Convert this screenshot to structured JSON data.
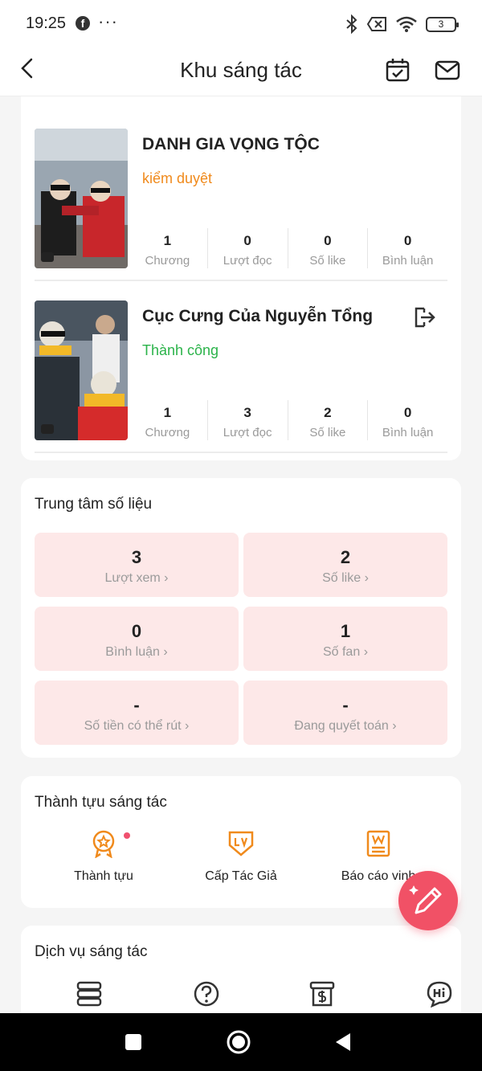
{
  "status_bar": {
    "time": "19:25",
    "battery": "3"
  },
  "header": {
    "title": "Khu sáng tác"
  },
  "works": [
    {
      "title": "DANH GIA VỌNG TỘC",
      "status": "kiểm duyệt",
      "status_color": "#f08a1c",
      "stats": [
        {
          "value": "1",
          "label": "Chương"
        },
        {
          "value": "0",
          "label": "Lượt đọc"
        },
        {
          "value": "0",
          "label": "Số like"
        },
        {
          "value": "0",
          "label": "Bình luận"
        }
      ]
    },
    {
      "title": "Cục Cưng Của Nguyễn Tổng",
      "status": "Thành công",
      "status_color": "#2bb34a",
      "stats": [
        {
          "value": "1",
          "label": "Chương"
        },
        {
          "value": "3",
          "label": "Lượt đọc"
        },
        {
          "value": "2",
          "label": "Số like"
        },
        {
          "value": "0",
          "label": "Bình luận"
        }
      ]
    }
  ],
  "data_center": {
    "title": "Trung tâm số liệu",
    "tiles": [
      {
        "value": "3",
        "label": "Lượt xem"
      },
      {
        "value": "2",
        "label": "Số like"
      },
      {
        "value": "0",
        "label": "Bình luận"
      },
      {
        "value": "1",
        "label": "Số fan"
      },
      {
        "value": "-",
        "label": "Số tiền có thể rút"
      },
      {
        "value": "-",
        "label": "Đang quyết toán"
      }
    ]
  },
  "achievements": {
    "title": "Thành tựu sáng tác",
    "items": [
      {
        "label": "Thành tựu",
        "icon": "medal-icon"
      },
      {
        "label": "Cấp Tác Giả",
        "icon": "level-badge-icon"
      },
      {
        "label": "Báo cáo vinh",
        "icon": "report-icon"
      }
    ]
  },
  "services": {
    "title": "Dịch vụ sáng tác",
    "icons": [
      "server-icon",
      "help-icon",
      "bill-icon",
      "chat-hi-icon"
    ]
  },
  "colors": {
    "accent": "#f15166",
    "orange": "#f08a1c",
    "tile_bg": "#fde8e8"
  }
}
